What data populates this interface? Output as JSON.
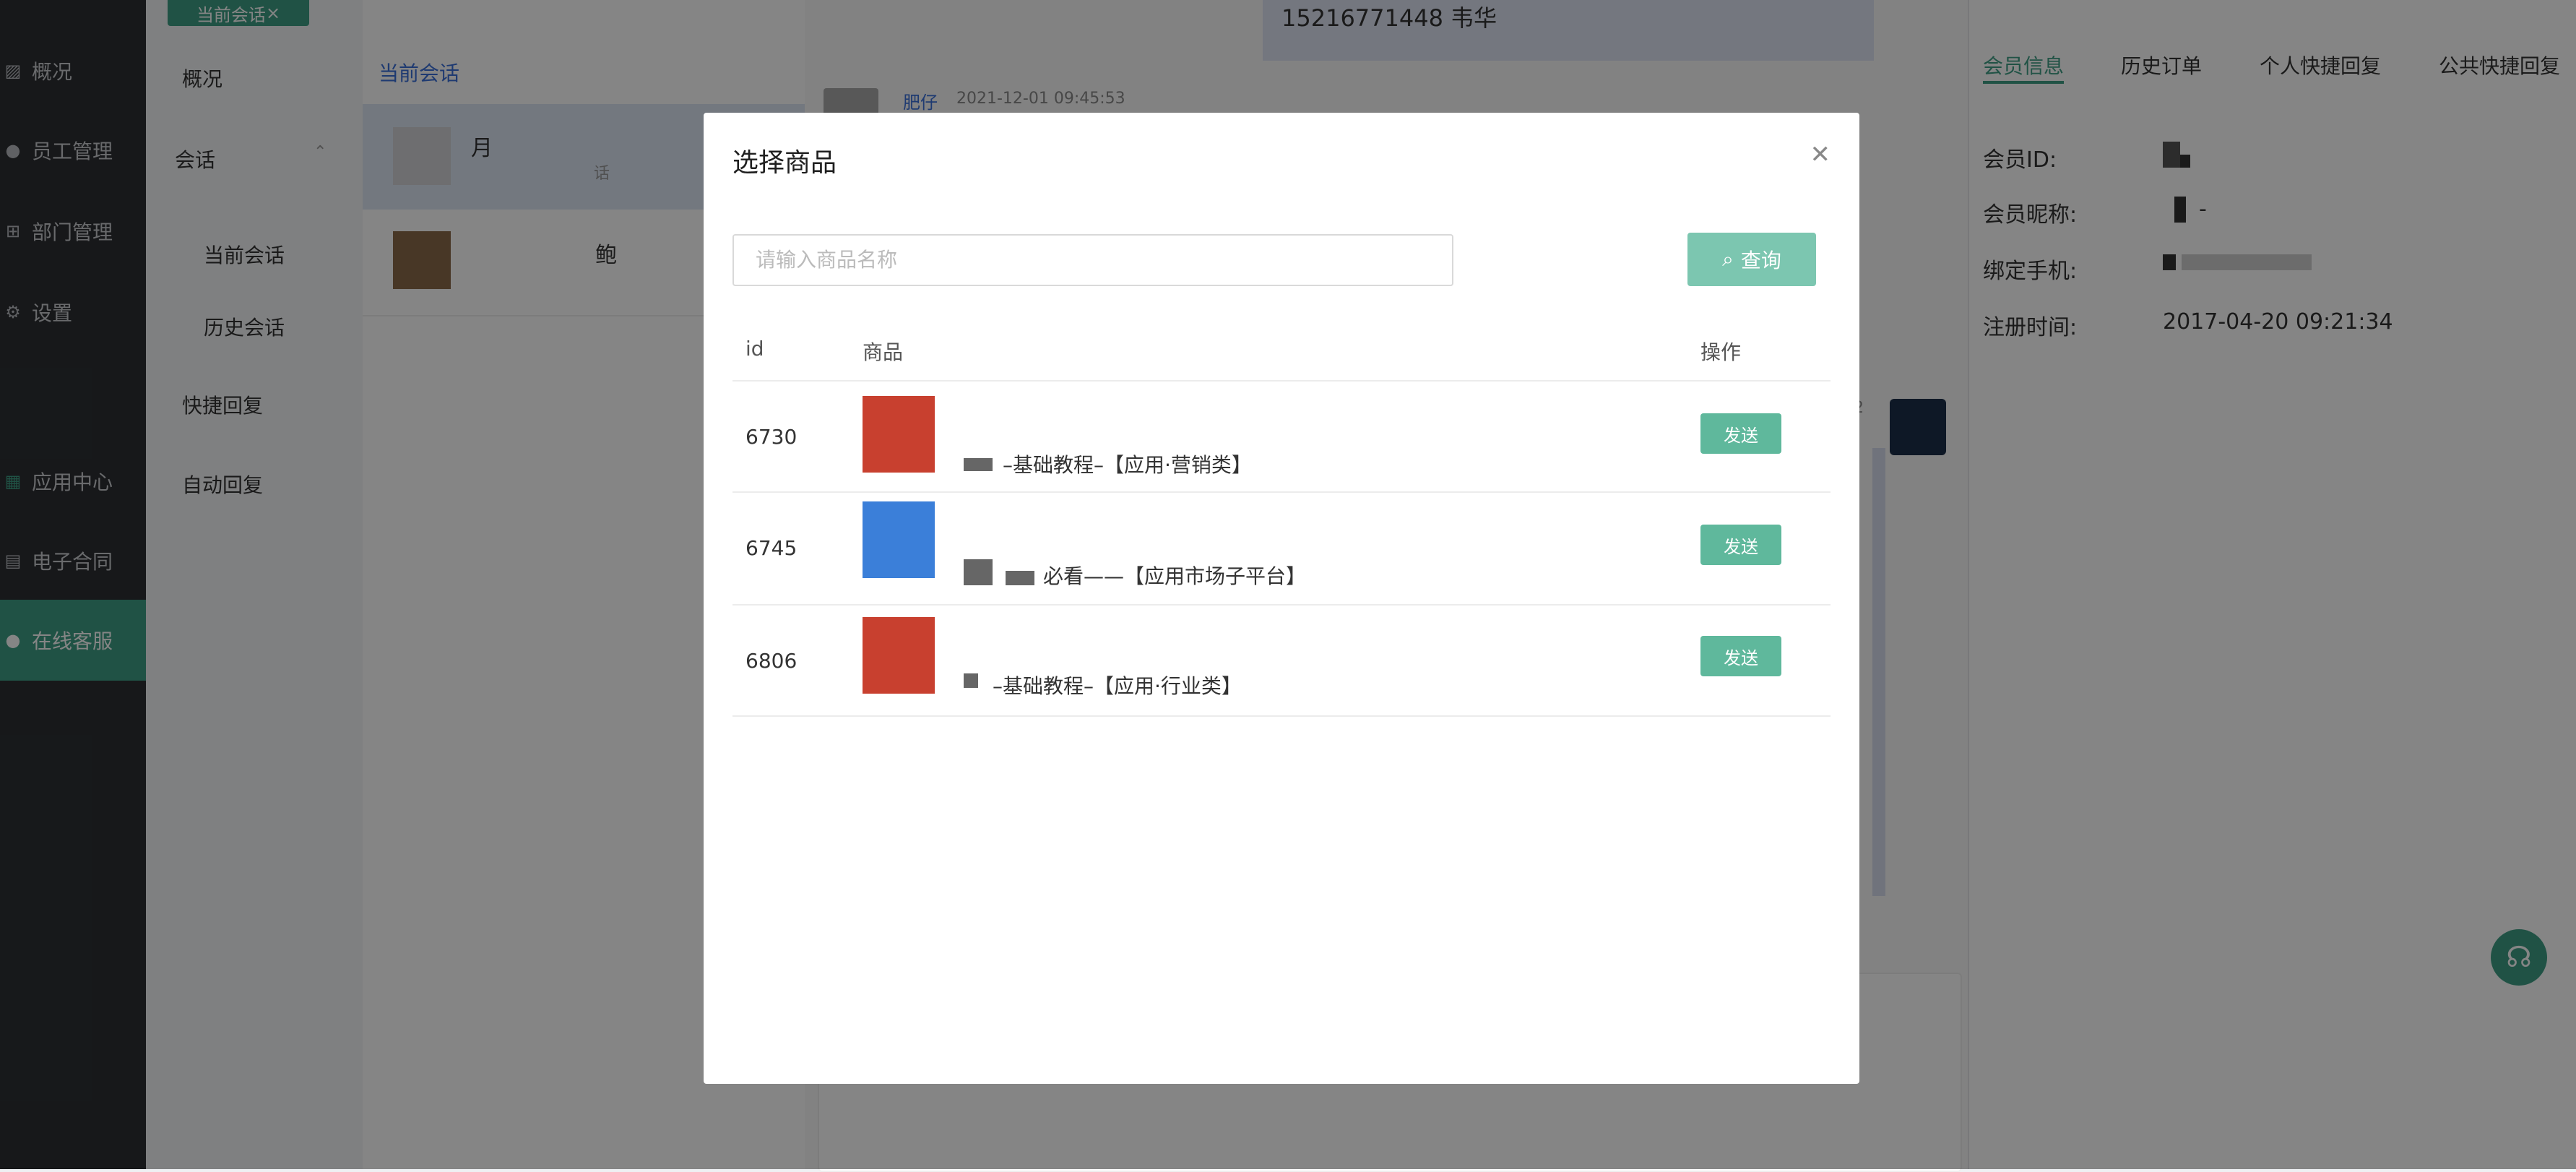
{
  "top_tab": {
    "label": "当前会话"
  },
  "sidebar": {
    "items": [
      {
        "label": "概况",
        "icon": "chart-icon"
      },
      {
        "label": "员工管理",
        "icon": "user-icon"
      },
      {
        "label": "部门管理",
        "icon": "org-icon"
      },
      {
        "label": "设置",
        "icon": "gear-icon"
      },
      {
        "label": "应用中心",
        "icon": "apps-icon"
      },
      {
        "label": "电子合同",
        "icon": "document-icon"
      },
      {
        "label": "在线客服",
        "icon": "support-user-icon"
      }
    ]
  },
  "subnav": {
    "overview": "概况",
    "session": "会话",
    "current_session": "当前会话",
    "history_session": "历史会话",
    "quick_reply": "快捷回复",
    "auto_reply": "自动回复"
  },
  "conversation_list": {
    "title": "当前会话",
    "items": [
      {
        "name": "月",
        "preview": "话"
      },
      {
        "name": "鲍",
        "preview": ""
      }
    ]
  },
  "chat": {
    "banner_text": "15216771448 韦华",
    "sender": "肥仔",
    "timestamp": "2021-12-01 09:45:53",
    "side_number": "2"
  },
  "right_panel": {
    "tabs": [
      "会员信息",
      "历史订单",
      "个人快捷回复",
      "公共快捷回复"
    ],
    "active_tab": 0,
    "fields": [
      {
        "label": "会员ID:",
        "value": ""
      },
      {
        "label": "会员昵称:",
        "value": "-"
      },
      {
        "label": "绑定手机:",
        "value": ""
      },
      {
        "label": "注册时间:",
        "value": "2017-04-20 09:21:34"
      }
    ]
  },
  "modal": {
    "title": "选择商品",
    "search_placeholder": "请输入商品名称",
    "search_value": "",
    "query_label": "查询",
    "columns": [
      "id",
      "商品",
      "操作"
    ],
    "rows": [
      {
        "id": "6730",
        "name": "–基础教程–【应用·营销类】",
        "action": "发送",
        "thumb_color": "#c8402f"
      },
      {
        "id": "6745",
        "name": "必看——【应用市场子平台】",
        "action": "发送",
        "thumb_color": "#3b7fd9"
      },
      {
        "id": "6806",
        "name": "–基础教程–【应用·行业类】",
        "action": "发送",
        "thumb_color": "#c8402f"
      }
    ]
  },
  "colors": {
    "brand_green": "#3e9e84",
    "button_green": "#5fb89c",
    "query_green": "#7cc6b0",
    "sidebar_bg": "#2d2f33",
    "link_blue": "#3a6fd8"
  }
}
